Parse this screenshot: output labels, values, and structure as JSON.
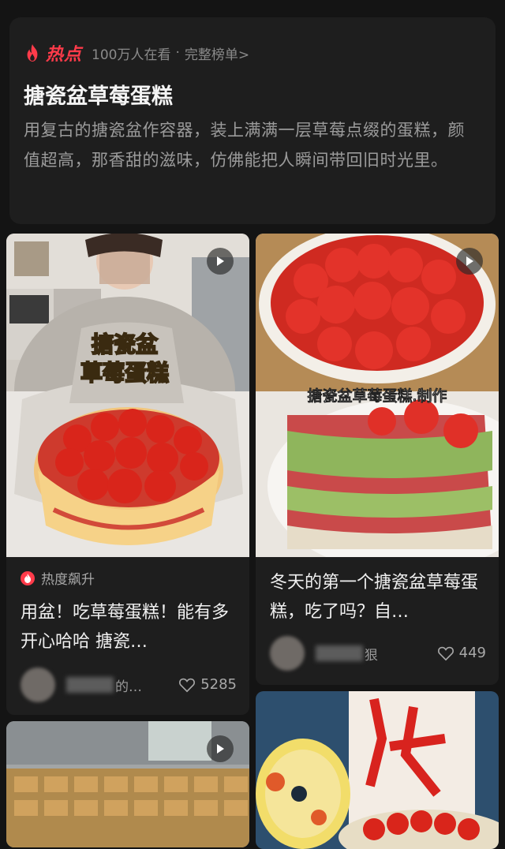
{
  "hot": {
    "label": "热点",
    "viewers": "100万人在看",
    "separator": "·",
    "full_list": "完整榜单>"
  },
  "topic": {
    "title": "搪瓷盆草莓蛋糕",
    "description": "用复古的搪瓷盆作容器，装上满满一层草莓点缀的蛋糕，颜值超高，那香甜的滋味，仿佛能把人瞬间带回旧时光里。"
  },
  "cards": [
    {
      "badge": "热度飙升",
      "overlay_text_1": "搪瓷盆",
      "overlay_text_2": "草莓蛋糕",
      "title": "用盆！吃草莓蛋糕！能有多开心哈哈 搪瓷…",
      "author_suffix": "的…",
      "likes": "5285"
    },
    {
      "overlay_text": "搪瓷盆草莓蛋糕.制作",
      "title": "冬天的第一个搪瓷盆草莓蛋糕，吃了吗？自…",
      "author_suffix": "狠",
      "likes": "449"
    },
    {},
    {}
  ],
  "colors": {
    "accent": "#ff3b4a",
    "background": "#141414",
    "card": "#1e1e1e"
  },
  "icons": [
    "flame-icon",
    "play-icon",
    "heart-outline-icon",
    "trend-flame-icon"
  ]
}
